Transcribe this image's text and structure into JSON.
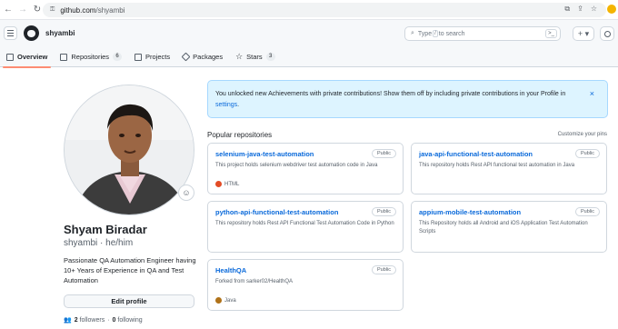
{
  "browser": {
    "url_host": "github.com",
    "url_path": "/shyambi"
  },
  "header": {
    "username": "shyambi",
    "search_text_before": "Type",
    "search_key": "/",
    "search_text_after": "to search",
    "plus_label": "+ ▾"
  },
  "tabs": [
    {
      "label": "Overview"
    },
    {
      "label": "Repositories",
      "count": "6"
    },
    {
      "label": "Projects"
    },
    {
      "label": "Packages"
    },
    {
      "label": "Stars",
      "count": "3"
    }
  ],
  "profile": {
    "name": "Shyam Biradar",
    "login": "shyambi",
    "pronouns": "he/him",
    "bio": "Passionate QA Automation Engineer having 10+ Years of Experience in QA and Test Automation",
    "edit_label": "Edit profile",
    "followers_count": "2",
    "followers_label": "followers",
    "following_count": "0",
    "following_label": "following"
  },
  "flash": {
    "text": "You unlocked new Achievements with private contributions! Show them off by including private contributions in your Profile in",
    "link": "settings",
    "period": ".",
    "close": "×"
  },
  "popular": {
    "title": "Popular repositories",
    "customize": "Customize your pins",
    "repos": [
      {
        "name": "selenium-java-test-automation",
        "visibility": "Public",
        "description": "This project holds selenium webdriver test automation code in Java",
        "language": "HTML",
        "language_color": "#e34c26"
      },
      {
        "name": "java-api-functional-test-automation",
        "visibility": "Public",
        "description": "This repository holds Rest API functional test automation in Java",
        "language": "",
        "language_color": ""
      },
      {
        "name": "python-api-functional-test-automation",
        "visibility": "Public",
        "description": "This repository holds Rest API Functional Test Automation Code in Python",
        "language": "",
        "language_color": ""
      },
      {
        "name": "appium-mobile-test-automation",
        "visibility": "Public",
        "description": "This Repository holds all Android and iOS Application Test Automation Scripts",
        "language": "",
        "language_color": ""
      },
      {
        "name": "HealthQA",
        "visibility": "Public",
        "description": "Forked from sarker02/HealthQA",
        "language": "Java",
        "language_color": "#b07219"
      }
    ]
  }
}
